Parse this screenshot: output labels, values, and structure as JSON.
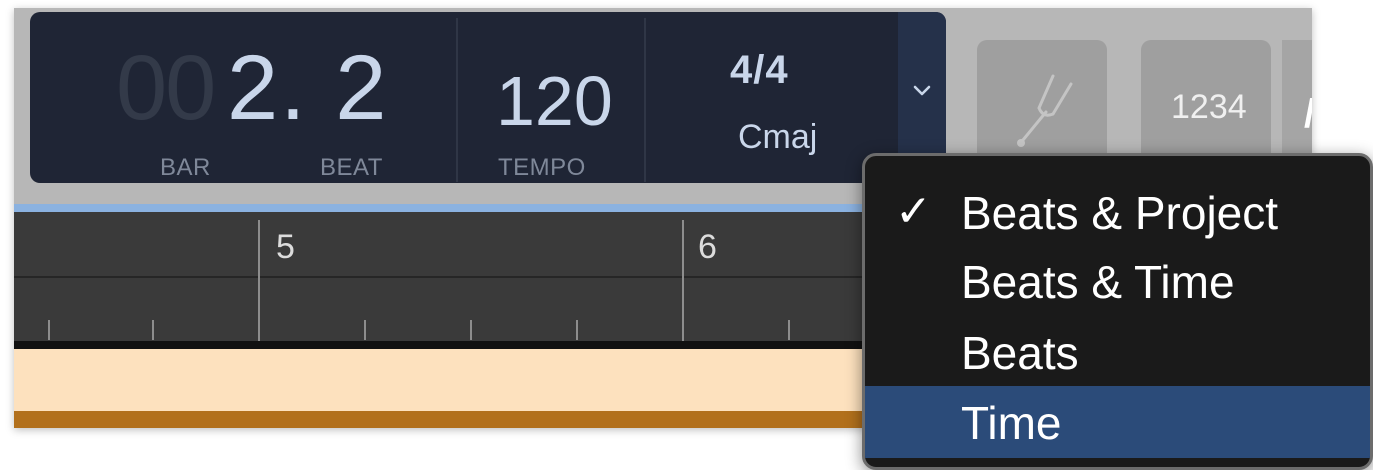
{
  "lcd": {
    "position_lead": "00",
    "position_value": "2. 2",
    "bar_label": "BAR",
    "beat_label": "BEAT",
    "tempo_value": "120",
    "tempo_label": "TEMPO",
    "time_signature": "4/4",
    "key": "Cmaj"
  },
  "toolbar": {
    "count_in_label": "1234",
    "next_glyph": "/"
  },
  "ruler": {
    "bars": [
      "5",
      "6"
    ]
  },
  "menu": {
    "items": [
      {
        "label": "Beats & Project",
        "checked": true
      },
      {
        "label": "Beats & Time",
        "checked": false
      },
      {
        "label": "Beats",
        "checked": false
      },
      {
        "label": "Time",
        "checked": false
      }
    ],
    "check_glyph": "✓",
    "highlighted": "Time"
  },
  "colors": {
    "lcd_background": "#1f2535",
    "lcd_text": "#c9d6ea",
    "menu_highlight": "#2b4b79",
    "track_region": "#fde1be",
    "track_border": "#b2701c",
    "ruler_accent": "#8bb2e0"
  },
  "icons": {
    "dropdown": "chevron-down-icon",
    "tuner": "tuning-fork-icon",
    "check": "checkmark-icon"
  }
}
